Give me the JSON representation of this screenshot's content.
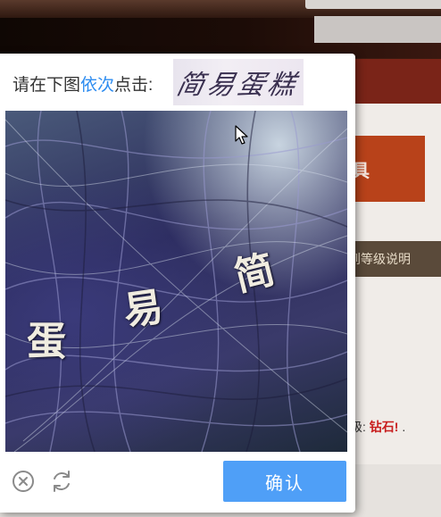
{
  "background": {
    "button_partial": "具",
    "strip_text": "到等级说明",
    "level_prefix": "级:",
    "level_value": "钻石!",
    "level_suffix": "."
  },
  "captcha": {
    "prompt_before": "请在下图",
    "prompt_emphasis": "依次",
    "prompt_after": "点击:",
    "hint_chars": "简易蛋糕",
    "image_chars": [
      "蛋",
      "易",
      "简"
    ],
    "confirm_label": "确认",
    "close_icon": "close-circle-icon",
    "refresh_icon": "refresh-icon",
    "accent_color": "#4f9ff7"
  }
}
